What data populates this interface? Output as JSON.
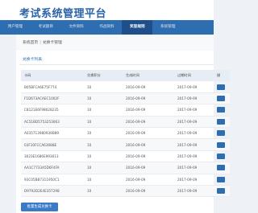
{
  "app": {
    "title": "考试系统管理平台"
  },
  "nav": {
    "items": [
      {
        "label": "用户管理"
      },
      {
        "label": "考试题目"
      },
      {
        "label": "文件资料"
      },
      {
        "label": "作战资料"
      },
      {
        "label": "奖惩规则",
        "active": true
      },
      {
        "label": "系统管理"
      },
      {
        "label": ""
      }
    ]
  },
  "breadcrumb": {
    "parent": "系统首页",
    "current": "兑换卡管理"
  },
  "panel": {
    "title": "兑换卡列表"
  },
  "table": {
    "headers": [
      "卡码",
      "兑换积分",
      "生成时间",
      "过期时间",
      "操"
    ],
    "rows": [
      [
        "B05BFCA6E75F774",
        "10",
        "2016-09-09",
        "2017-09-09"
      ],
      [
        "F1D673ACAEC1002F",
        "10",
        "2016-09-09",
        "2017-09-09"
      ],
      [
        "C8121E6F98028235",
        "10",
        "2016-09-09",
        "2017-09-09"
      ],
      [
        "AC51BD5753253063",
        "10",
        "2016-09-09",
        "2017-09-09"
      ],
      [
        "A035713980939B89",
        "10",
        "2016-09-09",
        "2017-09-09"
      ],
      [
        "03F10FCCA63088E",
        "10",
        "2016-09-09",
        "2017-09-09"
      ],
      [
        "3023E1686E993613",
        "10",
        "2016-09-09",
        "2017-09-09"
      ],
      [
        "AA1C7733A5D6F4FA",
        "10",
        "2016-09-09",
        "2017-09-09"
      ],
      [
        "93C05BB7311950C1",
        "10",
        "2016-09-09",
        "2017-09-09"
      ],
      [
        "D9792D2E4E357298",
        "10",
        "2016-09-09",
        "2017-09-09"
      ]
    ]
  },
  "actions": {
    "generate_label": "批量生成兑换卡"
  },
  "colors": {
    "nav": "#2f6db1",
    "nav_active": "#1f4f8a",
    "title": "#2a63a8",
    "header_row": "#e6edf5"
  }
}
